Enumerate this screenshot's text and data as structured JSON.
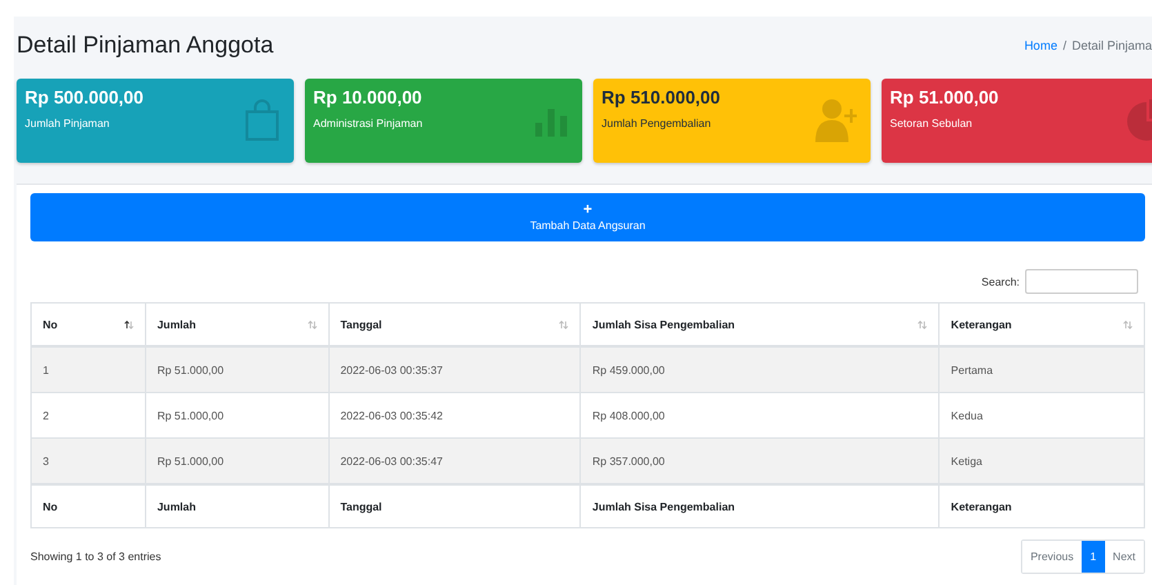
{
  "header": {
    "title": "Detail Pinjaman Anggota",
    "breadcrumb_separator": "/",
    "breadcrumb": [
      {
        "label": "Home",
        "kind": "link"
      },
      {
        "label": "Detail Pinjama",
        "kind": "current"
      }
    ]
  },
  "cards": [
    {
      "value": "Rp 500.000,00",
      "label": "Jumlah Pinjaman",
      "color": "#17a2b8",
      "kind": "bag"
    },
    {
      "value": "Rp 10.000,00",
      "label": "Administrasi Pinjaman",
      "color": "#28a745",
      "kind": "chart"
    },
    {
      "value": "Rp 510.000,00",
      "label": "Jumlah Pengembalian",
      "color": "#ffc107",
      "kind": "user"
    },
    {
      "value": "Rp 51.000,00",
      "label": "Setoran Sebulan",
      "color": "#dc3545",
      "kind": "pie"
    }
  ],
  "add_button": {
    "icon": "+",
    "label": "Tambah Data Angsuran"
  },
  "search": {
    "label": "Search:"
  },
  "table": {
    "columns": [
      {
        "label": "No",
        "sorted": true
      },
      {
        "label": "Jumlah",
        "sorted": false
      },
      {
        "label": "Tanggal",
        "sorted": false
      },
      {
        "label": "Jumlah Sisa Pengembalian",
        "sorted": false
      },
      {
        "label": "Keterangan",
        "sorted": false
      }
    ],
    "rows": [
      [
        "1",
        "Rp 51.000,00",
        "2022-06-03 00:35:37",
        "Rp 459.000,00",
        "Pertama"
      ],
      [
        "2",
        "Rp 51.000,00",
        "2022-06-03 00:35:42",
        "Rp 408.000,00",
        "Kedua"
      ],
      [
        "3",
        "Rp 51.000,00",
        "2022-06-03 00:35:47",
        "Rp 357.000,00",
        "Ketiga"
      ]
    ],
    "footer": [
      "No",
      "Jumlah",
      "Tanggal",
      "Jumlah Sisa Pengembalian",
      "Keterangan"
    ]
  },
  "info": "Showing 1 to 3 of 3 entries",
  "pagination": [
    {
      "label": "Previous",
      "selected": false
    },
    {
      "label": "1",
      "selected": true
    },
    {
      "label": "Next",
      "selected": false
    }
  ]
}
